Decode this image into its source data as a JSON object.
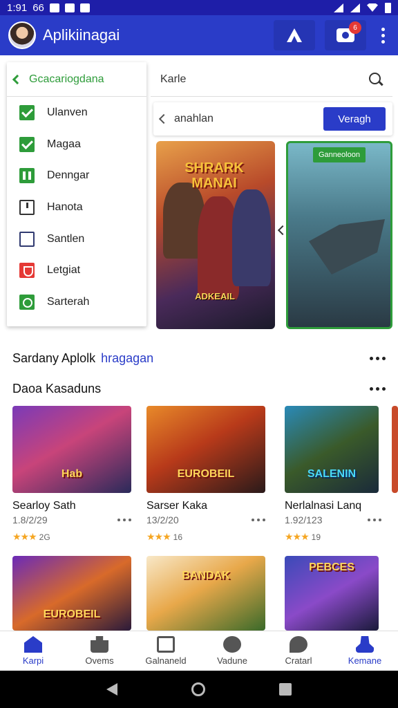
{
  "status_bar": {
    "time": "1:91",
    "carrier": "66"
  },
  "app_bar": {
    "title": "Aplikiinagai",
    "notification_count": "6"
  },
  "menu": {
    "header": "Gcacariogdana",
    "items": [
      {
        "label": "Ulanven",
        "icon": "checkbox-checked-icon"
      },
      {
        "label": "Magaa",
        "icon": "checkbox-checked-icon"
      },
      {
        "label": "Denngar",
        "icon": "grid-icon"
      },
      {
        "label": "Hanota",
        "icon": "document-icon"
      },
      {
        "label": "Santlen",
        "icon": "square-outline-icon"
      },
      {
        "label": "Letgiat",
        "icon": "shield-icon"
      },
      {
        "label": "Sarterah",
        "icon": "circle-check-icon"
      }
    ]
  },
  "search": {
    "value": "Karle"
  },
  "subbar": {
    "label": "anahlan",
    "button": "Veragh"
  },
  "featured": [
    {
      "title": "SHRARK MANAI",
      "subtitle": "ADKEAIL",
      "theme_color": "#e8a04a"
    },
    {
      "tag": "Ganneoloon",
      "theme_color": "#2e9c3a"
    }
  ],
  "section1": {
    "title": "Sardany Aplolk",
    "link": "hragagan"
  },
  "section2": {
    "title": "Daoa Kasaduns",
    "cards": [
      {
        "thumb_text": "Hab",
        "title": "Searloy Sath",
        "meta": "1.8/2/29",
        "rating": "2G"
      },
      {
        "thumb_text": "EUROBEIL",
        "title": "Sarser Kaka",
        "meta": "13/2/20",
        "rating": "16"
      },
      {
        "thumb_text": "SALENIN",
        "title": "Nerlalnasi Lanq",
        "meta": "1.92/123",
        "rating": "19"
      }
    ],
    "cards_row2": [
      {
        "thumb_text": "EUROBEIL"
      },
      {
        "thumb_text": "BANDAK"
      },
      {
        "thumb_text": "PEBCES"
      }
    ]
  },
  "bottom_nav": [
    {
      "label": "Karpi",
      "active": true,
      "icon": "home-icon"
    },
    {
      "label": "Ovems",
      "active": false,
      "icon": "bag-icon"
    },
    {
      "label": "Galnaneld",
      "active": false,
      "icon": "box-icon"
    },
    {
      "label": "Vadune",
      "active": false,
      "icon": "leaf-icon"
    },
    {
      "label": "Cratarl",
      "active": false,
      "icon": "chat-icon"
    },
    {
      "label": "Kemane",
      "active": true,
      "icon": "person-icon"
    }
  ],
  "colors": {
    "primary": "#2a3cc8",
    "status_bar": "#1e1ea8",
    "accent_green": "#2e9c3a",
    "star": "#f5a623"
  }
}
